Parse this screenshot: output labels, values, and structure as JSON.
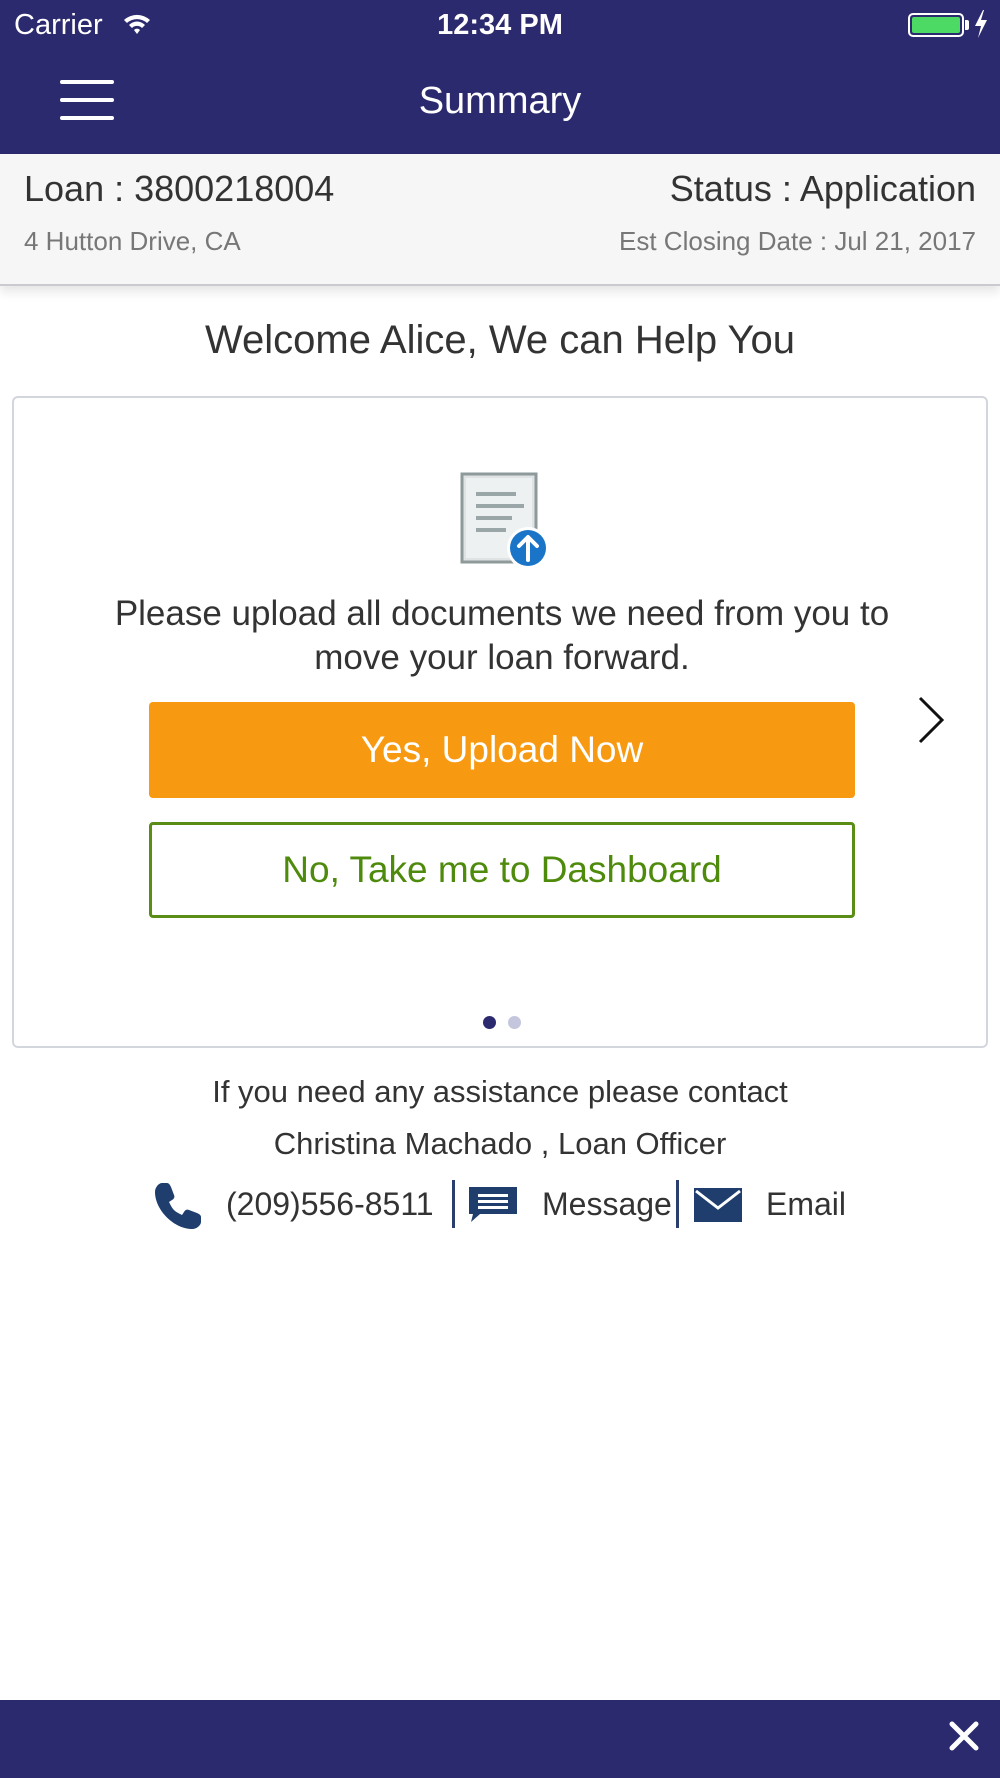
{
  "status_bar": {
    "carrier": "Carrier",
    "time": "12:34 PM",
    "icons": [
      "wifi-icon",
      "battery-icon",
      "charging-bolt-icon"
    ]
  },
  "nav": {
    "title": "Summary",
    "menu_icon": "hamburger-menu-icon"
  },
  "loan": {
    "number": "Loan : 3800218004",
    "status": "Status : Application",
    "address": "4 Hutton Drive, CA",
    "closing_date": "Est Closing Date : Jul 21, 2017"
  },
  "welcome": "Welcome Alice, We can Help You",
  "card": {
    "icon": "document-upload-icon",
    "message": "Please upload all documents we need from you to move your loan forward.",
    "primary_button": "Yes, Upload Now",
    "secondary_button": "No, Take me to Dashboard",
    "next_icon": "chevron-right-icon",
    "pages": 2,
    "current_page": 1
  },
  "assistance": {
    "text": "If you need any assistance please contact",
    "officer": "Christina Machado , Loan Officer",
    "phone": "(209)556-8511",
    "message_label": "Message",
    "email_label": "Email"
  },
  "footer": {
    "close_icon": "close-icon"
  },
  "colors": {
    "brand": "#2c2a6e",
    "primary_button": "#f79a12",
    "secondary_button": "#5a8d16",
    "contact_icons": "#1f3d6d"
  }
}
